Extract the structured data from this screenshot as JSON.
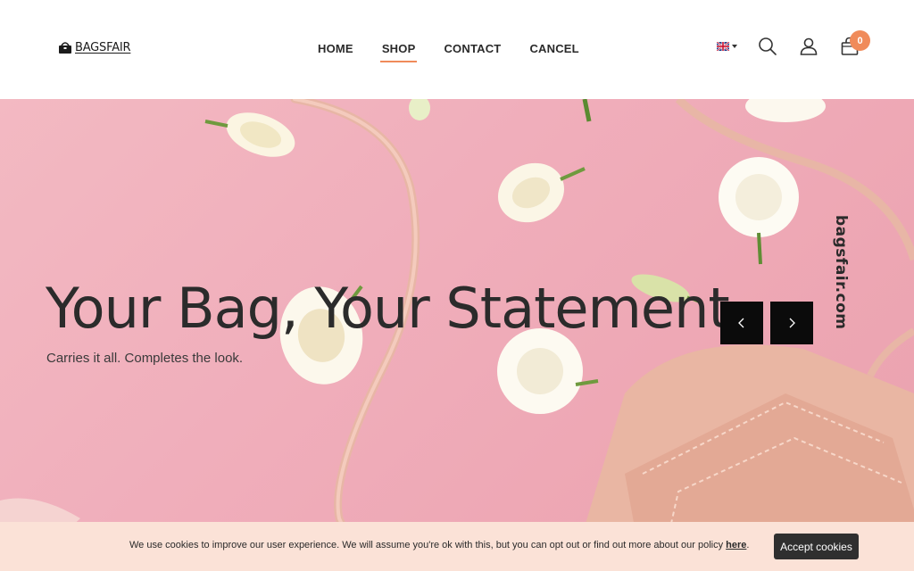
{
  "header": {
    "logo_text": "BAGSFAIR",
    "nav": [
      {
        "label": "HOME",
        "active": false
      },
      {
        "label": "SHOP",
        "active": true
      },
      {
        "label": "CONTACT",
        "active": false
      },
      {
        "label": "CANCEL",
        "active": false
      }
    ],
    "cart_count": "0",
    "icons": [
      "uk-flag-icon",
      "search-icon",
      "user-icon",
      "shopping-bag-icon"
    ]
  },
  "hero": {
    "title": "Your Bag, Your Statement",
    "subtitle": "Carries it all. Completes the look.",
    "side_brand": "bagsfair.com"
  },
  "cookie": {
    "text": "We use cookies to improve our user experience. We will assume you're ok with this, but you can opt out or find out more about our policy ",
    "link_text": "here",
    "after_link": ".",
    "button_label": "Accept cookies"
  },
  "colors": {
    "accent": "#f08b5a",
    "hero_bg": "#f0aebb",
    "cookie_bg": "#fbe2d7",
    "dark": "#0b0b0b"
  }
}
